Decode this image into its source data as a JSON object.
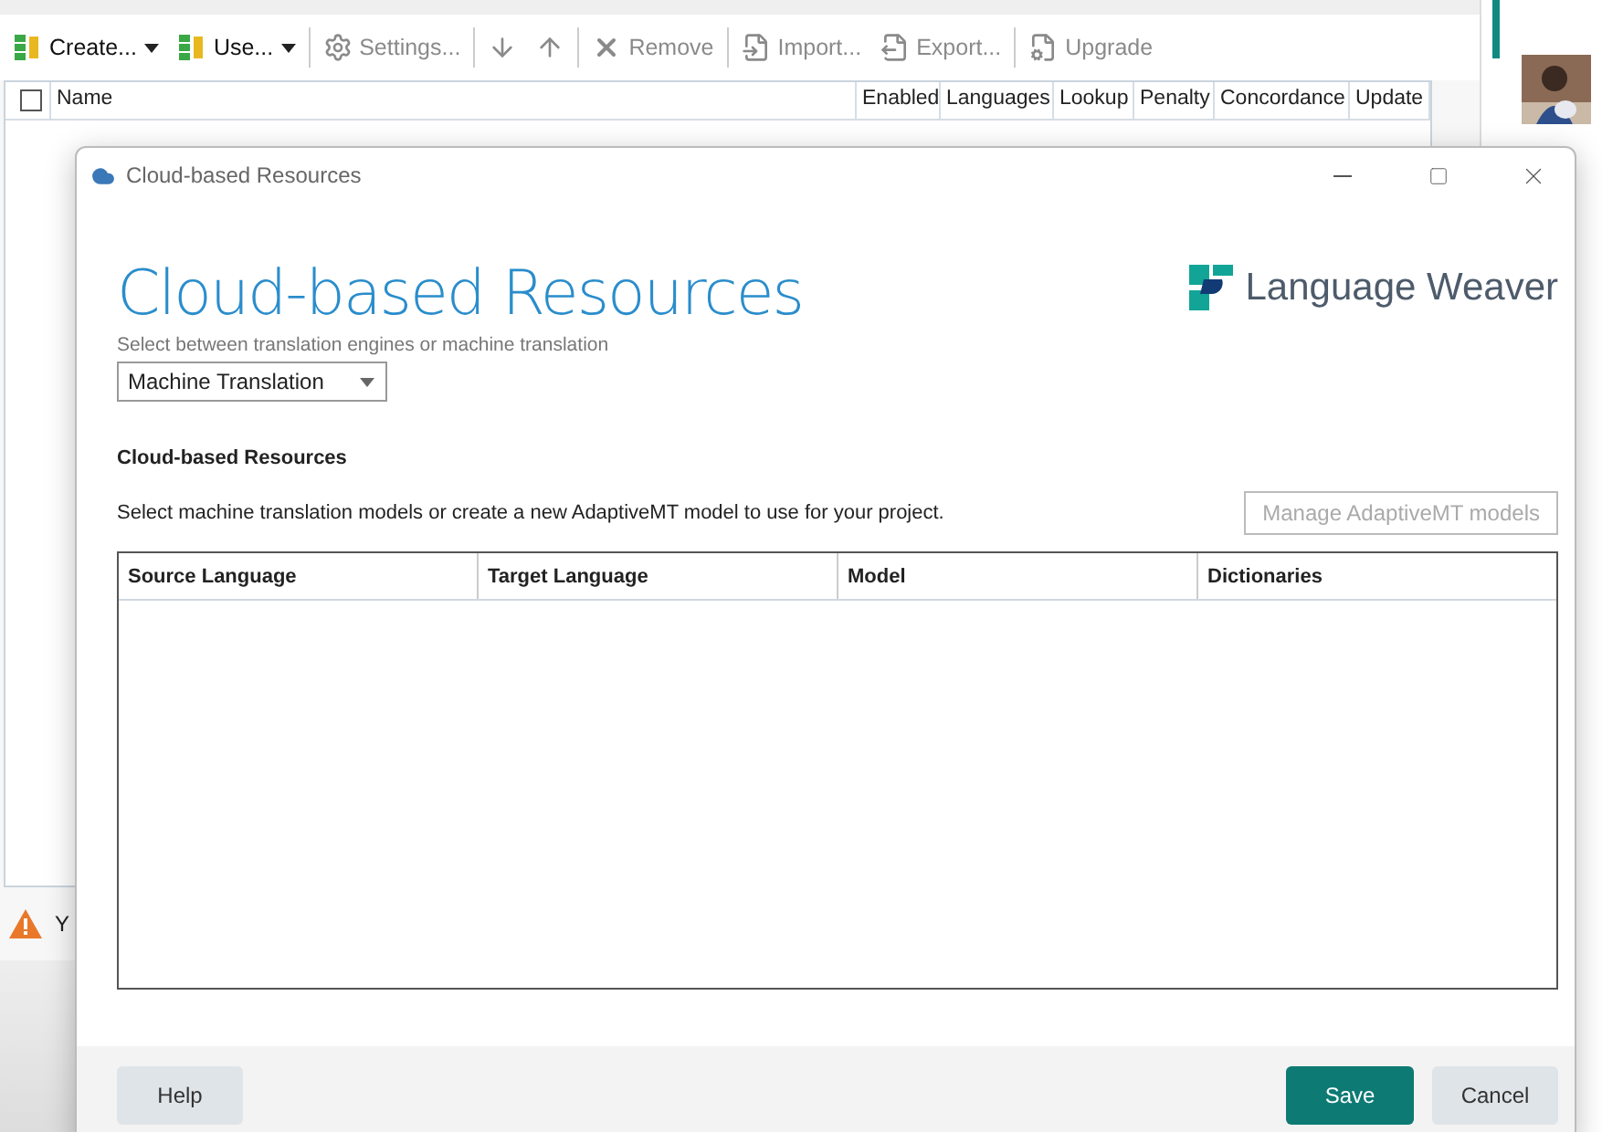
{
  "toolbar": [
    {
      "kind": "split",
      "label": "Create...",
      "disabled": false
    },
    {
      "kind": "split",
      "label": "Use...",
      "disabled": false
    },
    {
      "kind": "separator"
    },
    {
      "kind": "button",
      "label": "Settings...",
      "disabled": true
    },
    {
      "kind": "separator"
    },
    {
      "kind": "icon",
      "disabled": true
    },
    {
      "kind": "icon",
      "disabled": true
    },
    {
      "kind": "separator"
    },
    {
      "kind": "button",
      "label": "Remove",
      "disabled": true
    },
    {
      "kind": "separator"
    },
    {
      "kind": "button",
      "label": "Import...",
      "disabled": true
    },
    {
      "kind": "button",
      "label": "Export...",
      "disabled": true
    },
    {
      "kind": "separator"
    },
    {
      "kind": "button",
      "label": "Upgrade",
      "disabled": true
    }
  ],
  "resource_table": {
    "select_all": {
      "checked": false
    },
    "columns": [
      "Name",
      "Enabled",
      "Languages",
      "Lookup",
      "Penalty",
      "Concordance",
      "Update"
    ]
  },
  "warning": {
    "text": "Y"
  },
  "dialog": {
    "title": "Cloud-based Resources",
    "heading": "Cloud-based Resources",
    "logo_text": "Language Weaver",
    "select_label": "Select between translation engines or machine translation",
    "select_value": "Machine Translation",
    "section_title": "Cloud-based Resources",
    "description": "Select machine translation models or create a new AdaptiveMT model to use for your project.",
    "manage_button": {
      "label": "Manage AdaptiveMT models",
      "disabled": true
    },
    "columns": [
      "Source Language",
      "Target Language",
      "Model",
      "Dictionaries"
    ],
    "buttons": [
      {
        "label": "Help",
        "kind": "secondary"
      },
      {
        "label": "Save",
        "kind": "primary"
      },
      {
        "label": "Cancel",
        "kind": "secondary"
      }
    ]
  }
}
